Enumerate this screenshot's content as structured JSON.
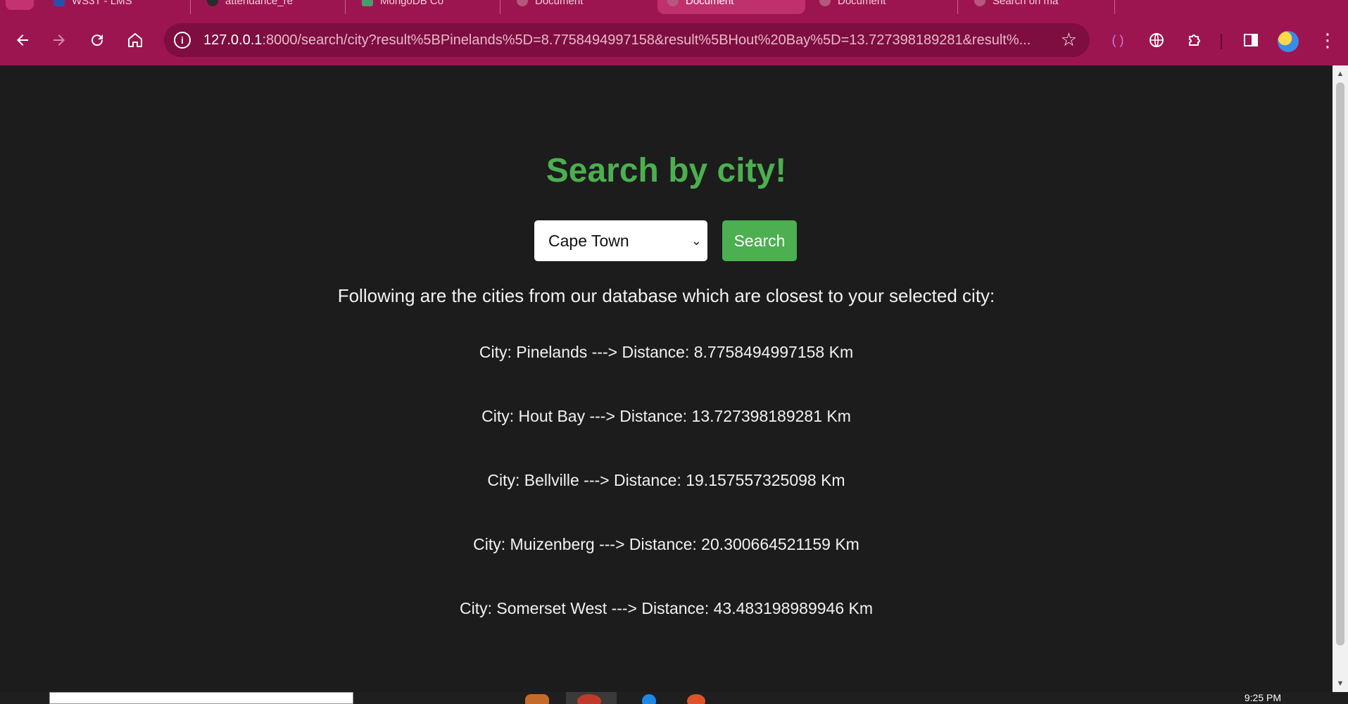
{
  "browser": {
    "tabs": [
      {
        "label": "WS3T - LMS"
      },
      {
        "label": "attendance_re"
      },
      {
        "label": "MongoDB Co"
      },
      {
        "label": "Document"
      },
      {
        "label": "Document"
      },
      {
        "label": "Document"
      },
      {
        "label": "Search on ma"
      }
    ],
    "url": {
      "host": "127.0.0.1",
      "rest": ":8000/search/city?result%5BPinelands%5D=8.7758494997158&result%5BHout%20Bay%5D=13.727398189281&result%..."
    },
    "icons": {
      "back": "arrow-left-icon",
      "forward": "arrow-right-icon",
      "reload": "reload-icon",
      "home": "home-icon",
      "site_info": "info-icon",
      "bookmark": "star-icon",
      "extension_a": "bracket-icon",
      "extension_b": "globe-icon",
      "extensions": "puzzle-icon",
      "side_panel": "side-panel-icon",
      "profile": "avatar",
      "menu": "kebab-menu-icon"
    }
  },
  "page": {
    "title": "Search by city!",
    "select": {
      "selected": "Cape Town"
    },
    "search_button": "Search",
    "intro": "Following are the cities from our database which are closest to your selected city:",
    "results": [
      {
        "text": "City: Pinelands ---> Distance: 8.7758494997158 Km"
      },
      {
        "text": "City: Hout Bay ---> Distance: 13.727398189281 Km"
      },
      {
        "text": "City: Bellville ---> Distance: 19.157557325098 Km"
      },
      {
        "text": "City: Muizenberg ---> Distance: 20.300664521159 Km"
      },
      {
        "text": "City: Somerset West ---> Distance: 43.483198989946 Km"
      }
    ]
  },
  "taskbar": {
    "clock": "9:25 PM"
  },
  "colors": {
    "chrome_frame": "#9d1550",
    "page_background": "#1c1c1c",
    "accent_green": "#4caf50"
  }
}
